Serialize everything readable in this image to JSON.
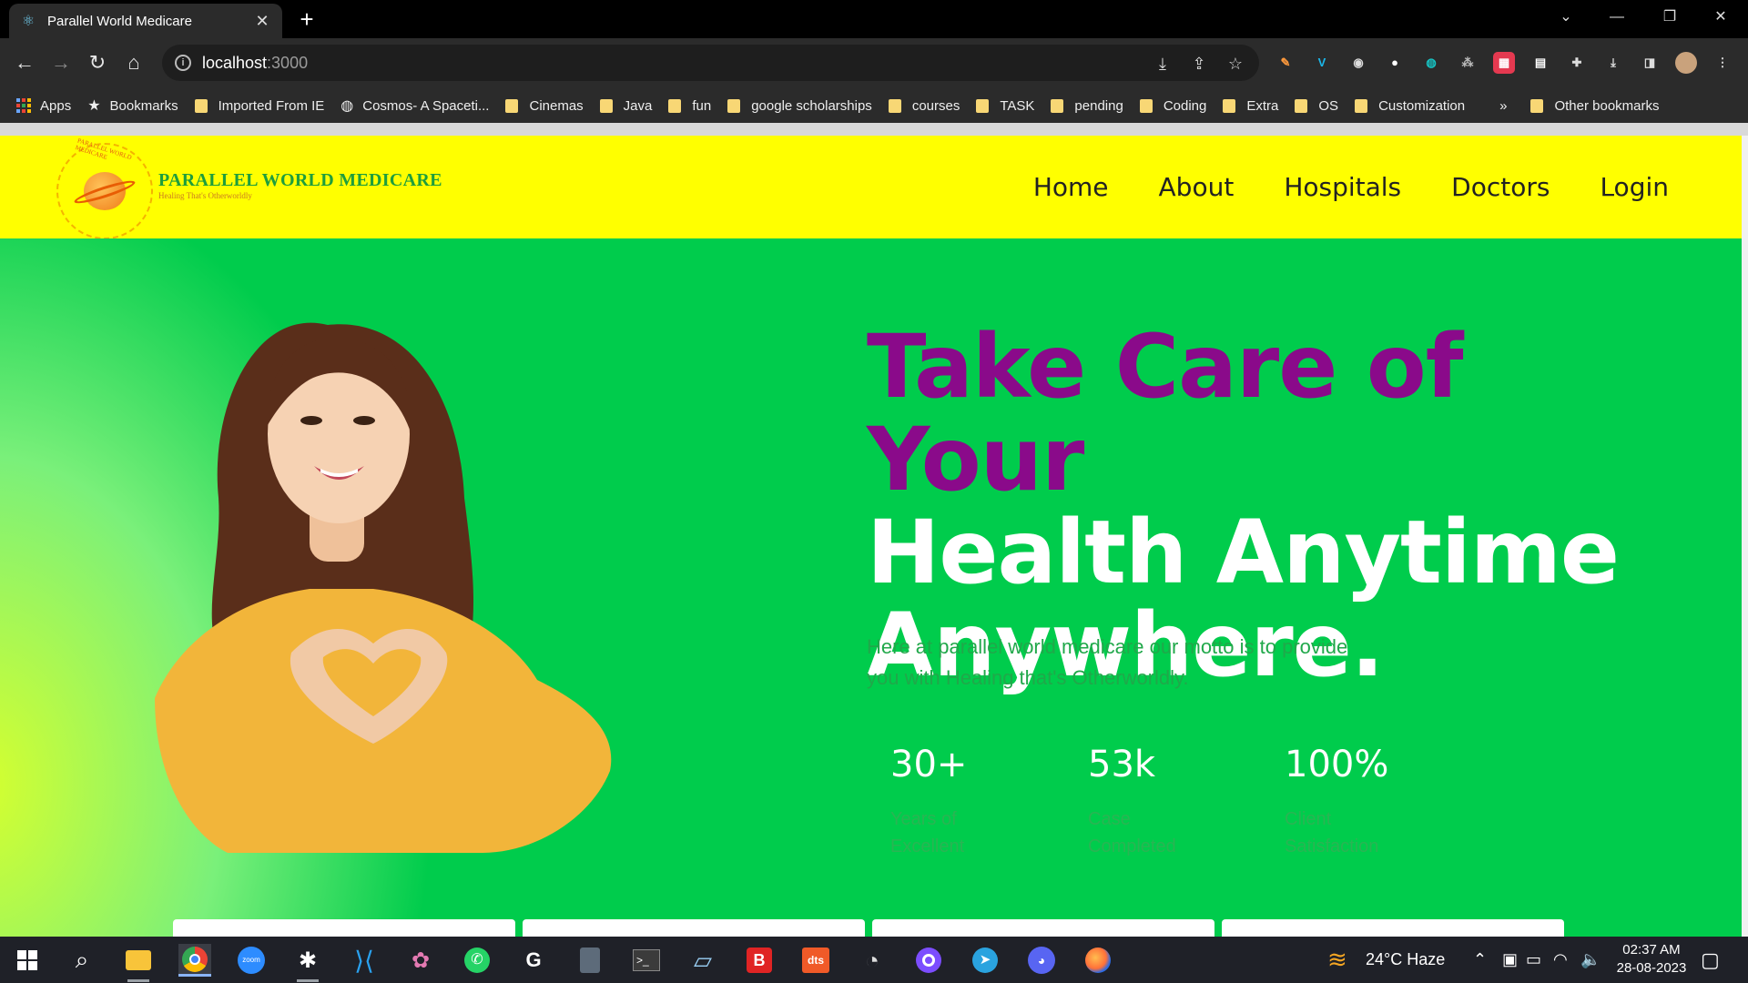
{
  "browser": {
    "tab": {
      "title": "Parallel World Medicare"
    },
    "url": {
      "host": "localhost",
      "port": ":3000"
    },
    "bookmarks": [
      {
        "label": "Apps",
        "icon": "apps-grid-icon"
      },
      {
        "label": "Bookmarks",
        "icon": "star-icon"
      },
      {
        "label": "Imported From IE",
        "icon": "folder-icon"
      },
      {
        "label": "Cosmos- A Spaceti...",
        "icon": "globe-icon"
      },
      {
        "label": "Cinemas",
        "icon": "folder-icon"
      },
      {
        "label": "Java",
        "icon": "folder-icon"
      },
      {
        "label": "fun",
        "icon": "folder-icon"
      },
      {
        "label": "google scholarships",
        "icon": "folder-icon"
      },
      {
        "label": "courses",
        "icon": "folder-icon"
      },
      {
        "label": "TASK",
        "icon": "folder-icon"
      },
      {
        "label": "pending",
        "icon": "folder-icon"
      },
      {
        "label": "Coding",
        "icon": "folder-icon"
      },
      {
        "label": "Extra",
        "icon": "folder-icon"
      },
      {
        "label": "OS",
        "icon": "folder-icon"
      },
      {
        "label": "Customization",
        "icon": "folder-icon"
      }
    ],
    "overflow": "»",
    "other_bookmarks": "Other bookmarks"
  },
  "site": {
    "brand": {
      "name": "PARALLEL WORLD MEDICARE",
      "tagline": "Healing That's Otherworldly",
      "seal_text": "PARALLEL WORLD MEDICARE"
    },
    "nav": [
      "Home",
      "About",
      "Hospitals",
      "Doctors",
      "Login"
    ],
    "hero": {
      "headline_line1": "Take Care of Your",
      "headline_line2": "Health Anytime",
      "headline_line3": "Anywhere.",
      "tagline_line1": "Here at parallel world medicare our motto is to provide",
      "tagline_line2": "you with Healing that's Otherworldly.",
      "stats": [
        {
          "value": "30+",
          "label_line1": "Years of",
          "label_line2": "Excellent"
        },
        {
          "value": "53k",
          "label_line1": "Case",
          "label_line2": "Completed"
        },
        {
          "value": "100%",
          "label_line1": "Client",
          "label_line2": "Satisfaction"
        }
      ]
    },
    "colors": {
      "nav_bg": "#ffff00",
      "hero_bg": "#00cc4c",
      "headline_accent": "#8a0a8a"
    }
  },
  "taskbar": {
    "weather": {
      "temp": "24°C",
      "condition": "Haze"
    },
    "clock": {
      "time": "02:37 AM",
      "date": "28-08-2023"
    }
  }
}
